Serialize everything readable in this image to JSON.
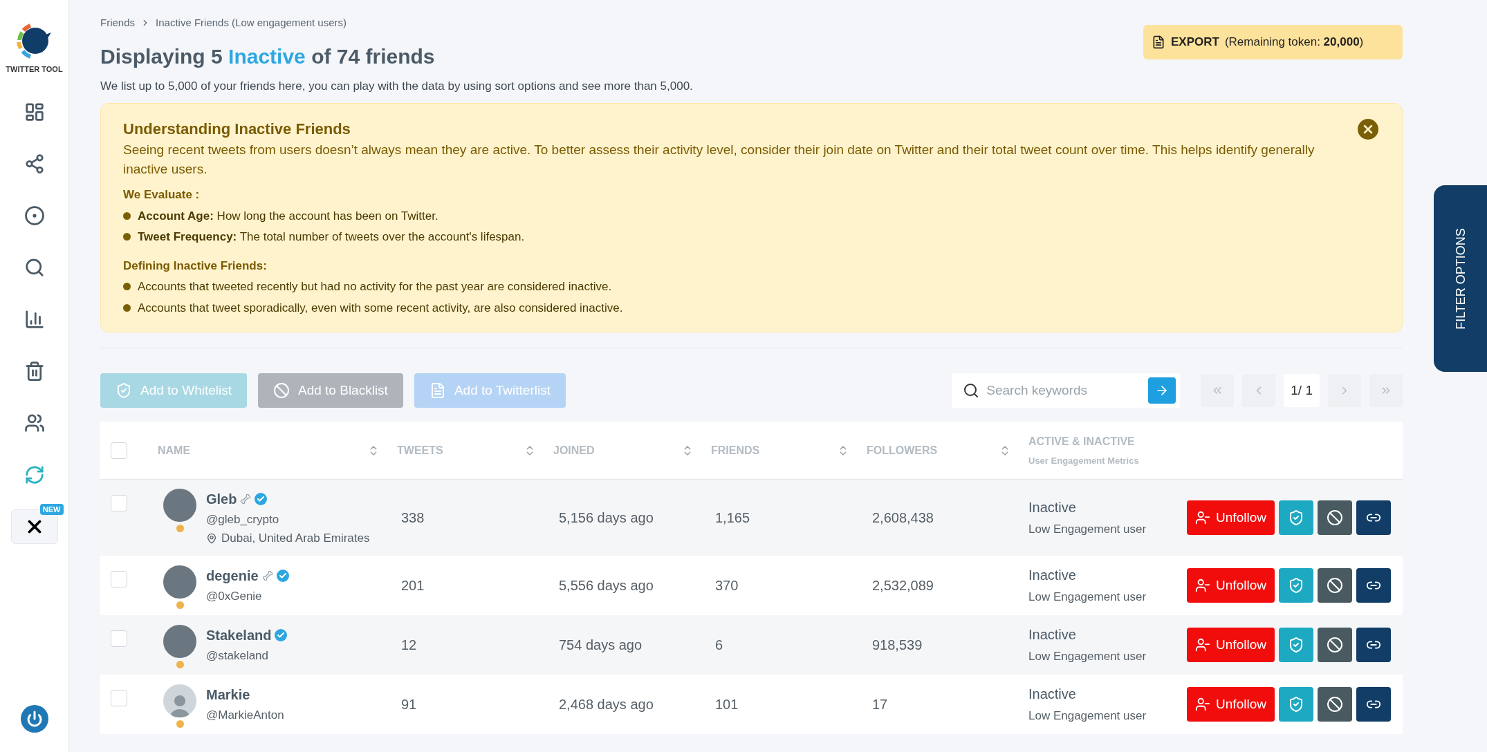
{
  "sidebar": {
    "logo_text": "TWITTER TOOL",
    "items": [
      {
        "kind": "dashboard",
        "selected": false
      },
      {
        "kind": "network",
        "selected": false
      },
      {
        "kind": "record",
        "selected": false
      },
      {
        "kind": "search",
        "selected": false
      },
      {
        "kind": "chart",
        "selected": false
      },
      {
        "kind": "trash",
        "selected": false
      },
      {
        "kind": "people",
        "selected": false
      },
      {
        "kind": "sync",
        "selected": true
      },
      {
        "kind": "x",
        "selected": false,
        "badge": "NEW"
      }
    ]
  },
  "breadcrumb": [
    "Friends",
    "Inactive Friends (Low engagement users)"
  ],
  "title": {
    "before": "Displaying 5 ",
    "highlight": "Inactive",
    "after": " of 74 friends"
  },
  "description": "We list up to 5,000 of your friends here, you can play with the data by using sort options and see more than 5,000.",
  "export": {
    "label": "EXPORT",
    "note": "(Remaining token: **20,000**)"
  },
  "info": {
    "title": "Understanding Inactive Friends",
    "text": "Seeing recent tweets from users doesn’t always mean they are active. To better assess their activity level, consider their join date on Twitter and their total tweet count over time. This helps identify generally inactive users.",
    "sections": [
      {
        "heading": "We Evaluate :",
        "bullets": [
          "**Account Age:** How long the account has been on Twitter.",
          "**Tweet Frequency:** The total number of tweets over the account's lifespan."
        ]
      },
      {
        "heading": "Defining Inactive Friends:",
        "bullets": [
          "Accounts that tweeted recently but had no activity for the past year are considered inactive.",
          "Accounts that tweet sporadically, even with some recent activity, are also considered inactive."
        ]
      }
    ]
  },
  "filter_tab": "FILTER OPTIONS",
  "toolbar": {
    "buttons": [
      {
        "kind": "whitelist",
        "label": "Add to Whitelist",
        "disabled": true
      },
      {
        "kind": "blacklist",
        "label": "Add to Blacklist",
        "disabled": true
      },
      {
        "kind": "twitterlist",
        "label": "Add to Twitterlist",
        "disabled": true
      }
    ],
    "search": {
      "placeholder": "Search keywords"
    },
    "pagination": {
      "page": "1/ 1",
      "disabled": true
    }
  },
  "table": {
    "select_all": {
      "checked": false
    },
    "columns": [
      {
        "label": "NAME",
        "sortable": true
      },
      {
        "label": "TWEETS",
        "sortable": true
      },
      {
        "label": "JOINED",
        "sortable": true
      },
      {
        "label": "FRIENDS",
        "sortable": true
      },
      {
        "label": "FOLLOWERS",
        "sortable": true
      },
      {
        "label": "ACTIVE & INACTIVE",
        "sub": "User Engagement Metrics",
        "sortable": false
      }
    ],
    "rows": [
      {
        "checked": false,
        "has_photo": true,
        "name": "Gleb",
        "bone": true,
        "verified": true,
        "handle": "@gleb_crypto",
        "location": "Dubai, United Arab Emirates",
        "tweets": "338",
        "joined": "5,156 days ago",
        "friends": "1,165",
        "followers": "2,608,438",
        "status": "Inactive",
        "engagement": "Low Engagement user",
        "action": "Unfollow"
      },
      {
        "checked": false,
        "has_photo": true,
        "name": "degenie",
        "bone": true,
        "verified": true,
        "handle": "@0xGenie",
        "tweets": "201",
        "joined": "5,556 days ago",
        "friends": "370",
        "followers": "2,532,089",
        "status": "Inactive",
        "engagement": "Low Engagement user",
        "action": "Unfollow"
      },
      {
        "checked": false,
        "has_photo": true,
        "name": "Stakeland",
        "bone": false,
        "verified": true,
        "handle": "@stakeland",
        "tweets": "12",
        "joined": "754 days ago",
        "friends": "6",
        "followers": "918,539",
        "status": "Inactive",
        "engagement": "Low Engagement user",
        "action": "Unfollow"
      },
      {
        "checked": false,
        "has_photo": false,
        "name": "Markie",
        "bone": false,
        "verified": false,
        "handle": "@MarkieAnton",
        "tweets": "91",
        "joined": "2,468 days ago",
        "friends": "101",
        "followers": "17",
        "status": "Inactive",
        "engagement": "Low Engagement user",
        "action": "Unfollow"
      }
    ]
  }
}
